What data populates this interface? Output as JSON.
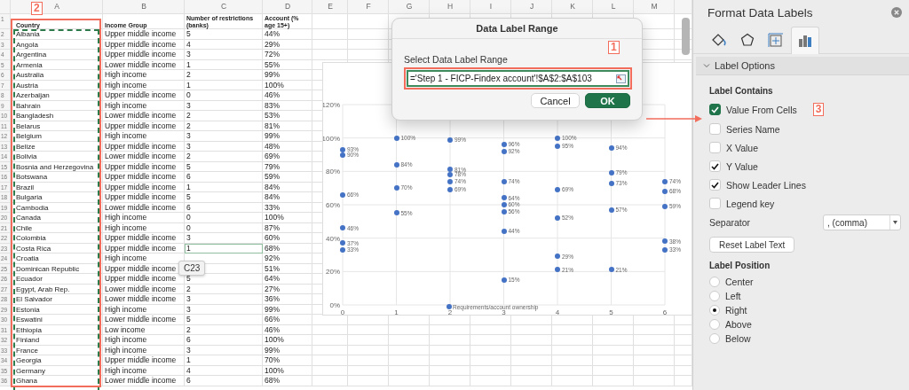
{
  "spreadsheet": {
    "columns": [
      "A",
      "B",
      "C",
      "D",
      "E",
      "F",
      "G",
      "H",
      "I",
      "J",
      "K",
      "L",
      "M"
    ],
    "copy_marquee": true,
    "annotation": {
      "label": "2"
    },
    "header_row": {
      "number": "1",
      "cells": [
        "Country",
        "Income Group",
        "Number of restrictions (banks)",
        "Account (% age 15+)"
      ]
    },
    "rows": [
      {
        "number": "2",
        "cells": [
          "Albania",
          "Upper middle income",
          "5",
          "44%"
        ]
      },
      {
        "number": "3",
        "cells": [
          "Angola",
          "Upper middle income",
          "4",
          "29%"
        ]
      },
      {
        "number": "4",
        "cells": [
          "Argentina",
          "Upper middle income",
          "3",
          "72%"
        ]
      },
      {
        "number": "5",
        "cells": [
          "Armenia",
          "Lower middle income",
          "1",
          "55%"
        ]
      },
      {
        "number": "6",
        "cells": [
          "Australia",
          "High income",
          "2",
          "99%"
        ]
      },
      {
        "number": "7",
        "cells": [
          "Austria",
          "High income",
          "1",
          "100%"
        ]
      },
      {
        "number": "8",
        "cells": [
          "Azerbaijan",
          "Upper middle income",
          "0",
          "46%"
        ]
      },
      {
        "number": "9",
        "cells": [
          "Bahrain",
          "High income",
          "3",
          "83%"
        ]
      },
      {
        "number": "10",
        "cells": [
          "Bangladesh",
          "Lower middle income",
          "2",
          "53%"
        ]
      },
      {
        "number": "11",
        "cells": [
          "Belarus",
          "Upper middle income",
          "2",
          "81%"
        ]
      },
      {
        "number": "12",
        "cells": [
          "Belgium",
          "High income",
          "3",
          "99%"
        ]
      },
      {
        "number": "13",
        "cells": [
          "Belize",
          "Upper middle income",
          "3",
          "48%"
        ]
      },
      {
        "number": "14",
        "cells": [
          "Bolivia",
          "Lower middle income",
          "2",
          "69%"
        ]
      },
      {
        "number": "15",
        "cells": [
          "Bosnia and Herzegovina",
          "Upper middle income",
          "5",
          "79%"
        ]
      },
      {
        "number": "16",
        "cells": [
          "Botswana",
          "Upper middle income",
          "6",
          "59%"
        ]
      },
      {
        "number": "17",
        "cells": [
          "Brazil",
          "Upper middle income",
          "1",
          "84%"
        ]
      },
      {
        "number": "18",
        "cells": [
          "Bulgaria",
          "Upper middle income",
          "5",
          "84%"
        ]
      },
      {
        "number": "19",
        "cells": [
          "Cambodia",
          "Lower middle income",
          "6",
          "33%"
        ]
      },
      {
        "number": "20",
        "cells": [
          "Canada",
          "High income",
          "0",
          "100%"
        ]
      },
      {
        "number": "21",
        "cells": [
          "Chile",
          "High income",
          "0",
          "87%"
        ]
      },
      {
        "number": "22",
        "cells": [
          "Colombia",
          "Upper middle income",
          "3",
          "60%"
        ]
      },
      {
        "number": "23",
        "cells": [
          "Costa Rica",
          "Upper middle income",
          {
            "text": "1",
            "selected": true
          },
          "68%"
        ]
      },
      {
        "number": "24",
        "cells": [
          "Croatia",
          "High income",
          null,
          "92%"
        ]
      },
      {
        "number": "25",
        "cells": [
          "Dominican Republic",
          "Upper middle income",
          null,
          "51%"
        ]
      },
      {
        "number": "26",
        "cells": [
          "Ecuador",
          "Upper middle income",
          "5",
          "64%"
        ]
      },
      {
        "number": "27",
        "cells": [
          "Egypt, Arab Rep.",
          "Lower middle income",
          "2",
          "27%"
        ]
      },
      {
        "number": "28",
        "cells": [
          "El Salvador",
          "Lower middle income",
          "3",
          "36%"
        ]
      },
      {
        "number": "29",
        "cells": [
          "Estonia",
          "High income",
          "3",
          "99%"
        ]
      },
      {
        "number": "30",
        "cells": [
          "Eswatini",
          "Lower middle income",
          "5",
          "66%"
        ]
      },
      {
        "number": "31",
        "cells": [
          "Ethiopia",
          "Low income",
          "2",
          "46%"
        ]
      },
      {
        "number": "32",
        "cells": [
          "Finland",
          "High income",
          "6",
          "100%"
        ]
      },
      {
        "number": "33",
        "cells": [
          "France",
          "High income",
          "3",
          "99%"
        ]
      },
      {
        "number": "34",
        "cells": [
          "Georgia",
          "Upper middle income",
          "1",
          "70%"
        ]
      },
      {
        "number": "35",
        "cells": [
          "Germany",
          "High income",
          "4",
          "100%"
        ]
      },
      {
        "number": "36",
        "cells": [
          "Ghana",
          "Lower middle income",
          "6",
          "68%"
        ]
      }
    ],
    "cell_tooltip": "C23",
    "chart": {
      "chart_data": {
        "type": "scatter",
        "x": [
          0,
          0,
          0,
          0,
          0,
          0,
          1,
          1,
          1,
          1,
          2,
          2,
          2,
          2,
          2,
          3,
          3,
          3,
          3,
          3,
          3,
          3,
          3,
          4,
          4,
          4,
          4,
          4,
          4,
          5,
          5,
          5,
          5,
          5,
          6,
          6,
          6,
          6,
          6
        ],
        "series": [
          {
            "name": "Requirements/account ownership",
            "color": "#4472c4",
            "values": [
              0.93,
              0.9,
              0.66,
              0.46,
              0.37,
              0.33,
              1.0,
              0.84,
              0.7,
              0.55,
              0.99,
              0.81,
              0.78,
              0.74,
              0.69,
              0.96,
              0.92,
              0.74,
              0.64,
              0.6,
              0.56,
              0.44,
              0.15,
              1.0,
              0.95,
              0.69,
              0.52,
              0.29,
              0.21,
              0.94,
              0.79,
              0.73,
              0.57,
              0.21,
              0.74,
              0.68,
              0.59,
              0.38,
              0.33
            ]
          }
        ],
        "value_labels": [
          "93%",
          "90%",
          "66%",
          "46%",
          "37%",
          "33%",
          "100%",
          "84%",
          "70%",
          "55%",
          "99%",
          "81%",
          "78%",
          "74%",
          "69%",
          "96%",
          "92%",
          "74%",
          "64%",
          "60%",
          "56%",
          "44%",
          "15%",
          "100%",
          "95%",
          "69%",
          "52%",
          "29%",
          "21%",
          "94%",
          "79%",
          "73%",
          "57%",
          "21%",
          "74%",
          "68%",
          "59%",
          "38%",
          "33%"
        ],
        "xticks": [
          0,
          1,
          2,
          3,
          4,
          5,
          6
        ],
        "yticks": [
          {
            "value": 0,
            "label": "0%"
          },
          {
            "value": 0.2,
            "label": "20%"
          },
          {
            "value": 0.4,
            "label": "40%"
          },
          {
            "value": 0.6,
            "label": "60%"
          },
          {
            "value": 0.8,
            "label": "80%"
          },
          {
            "value": 1.0,
            "label": "100%"
          },
          {
            "value": 1.2,
            "label": "120%"
          }
        ],
        "ylim": [
          0,
          1.2
        ],
        "xlim": [
          0,
          6
        ],
        "grid": true
      }
    }
  },
  "dialog": {
    "title": "Data Label Range",
    "label": "Select Data Label Range",
    "field": {
      "value": "='Step 1 - FICP-Findex account'!$A$2:$A$103",
      "annotation": {
        "label": "1"
      }
    },
    "buttons": [
      {
        "label": "Cancel",
        "kind": "secondary"
      },
      {
        "label": "OK",
        "kind": "primary"
      }
    ]
  },
  "panel": {
    "title": "Format Data Labels",
    "tabs": [
      {
        "kind": "fill",
        "selected": false
      },
      {
        "kind": "effects",
        "selected": false
      },
      {
        "kind": "size",
        "selected": false
      },
      {
        "kind": "options",
        "selected": true
      }
    ],
    "section": {
      "title": "Label Options",
      "expanded": true
    },
    "contains_heading": "Label Contains",
    "checkboxes": [
      {
        "label": "Value From Cells",
        "checked": true,
        "kind": "accent",
        "annotation": {
          "label": "3"
        }
      },
      {
        "label": "Series Name",
        "checked": false,
        "kind": "plain"
      },
      {
        "label": "X Value",
        "checked": false,
        "kind": "plain"
      },
      {
        "label": "Y Value",
        "checked": true,
        "kind": "plain"
      },
      {
        "label": "Show Leader Lines",
        "checked": true,
        "kind": "plain"
      },
      {
        "label": "Legend key",
        "checked": false,
        "kind": "plain"
      }
    ],
    "separator": {
      "label": "Separator",
      "value": ", (comma)"
    },
    "reset_button": "Reset Label Text",
    "position_heading": "Label Position",
    "positions": [
      {
        "label": "Center",
        "selected": false
      },
      {
        "label": "Left",
        "selected": false
      },
      {
        "label": "Right",
        "selected": true
      },
      {
        "label": "Above",
        "selected": false
      },
      {
        "label": "Below",
        "selected": false
      }
    ]
  }
}
